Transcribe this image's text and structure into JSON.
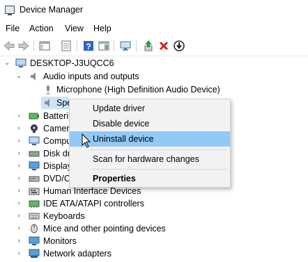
{
  "window": {
    "title": "Device Manager"
  },
  "menu": [
    "File",
    "Action",
    "View",
    "Help"
  ],
  "toolbar": {
    "icons": [
      "back-arrow-icon",
      "forward-arrow-icon",
      "show-hide-tree-icon",
      "properties-icon",
      "help-icon",
      "action-pane-icon",
      "monitor-scan-icon",
      "update-driver-icon",
      "uninstall-x-icon",
      "disable-device-icon"
    ]
  },
  "tree": {
    "root": "DESKTOP-J3UQCC6",
    "audio": "Audio inputs and outputs",
    "microphone": "Microphone (High Definition Audio Device)",
    "speakers_partial": "Spe",
    "categories": [
      "Batteries",
      "Cameras",
      "Computer",
      "Disk drives",
      "Display adapters",
      "DVD/CD-ROM drives",
      "Human Interface Devices",
      "IDE ATA/ATAPI controllers",
      "Keyboards",
      "Mice and other pointing devices",
      "Monitors",
      "Network adapters"
    ],
    "visible_labels": [
      "Batteri",
      "Camer",
      "Compu",
      "Disk dr",
      "Display",
      "DVD/C",
      "Human Interface Devices",
      "IDE ATA/ATAPI controllers",
      "Keyboards",
      "Mice and other pointing devices",
      "Monitors",
      "Network adapters"
    ]
  },
  "context_menu": {
    "items": [
      "Update driver",
      "Disable device",
      "Uninstall device",
      "Scan for hardware changes",
      "Properties"
    ],
    "highlighted": "Uninstall device",
    "highlight_color": "#91c9f7"
  }
}
